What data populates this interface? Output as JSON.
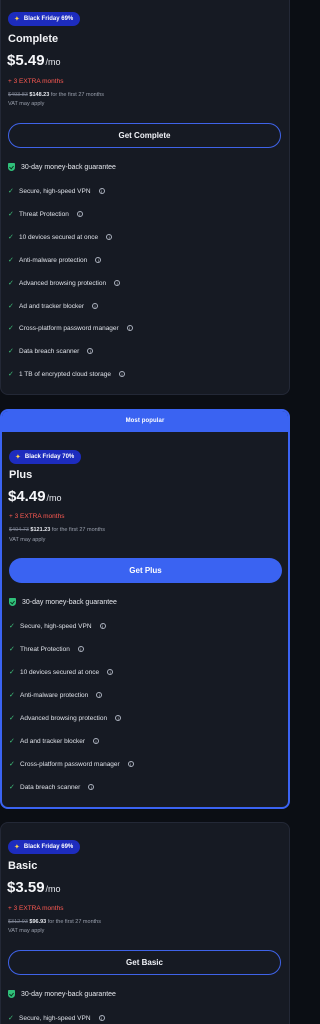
{
  "plans": [
    {
      "badge": "Black Friday 69%",
      "name": "Complete",
      "price": "$5.49",
      "per": "/mo",
      "extra": "+ 3 EXTRA months",
      "old_price": "$493.83",
      "new_price": "$148.23",
      "term": "for the first 27 months",
      "vat": "VAT may apply",
      "cta": "Get Complete",
      "guarantee": "30-day money-back guarantee",
      "features": [
        "Secure, high-speed VPN",
        "Threat Protection",
        "10 devices secured at once",
        "Anti-malware protection",
        "Advanced browsing protection",
        "Ad and tracker blocker",
        "Cross-platform password manager",
        "Data breach scanner",
        "1 TB of encrypted cloud storage"
      ]
    },
    {
      "popular": "Most popular",
      "badge": "Black Friday 70%",
      "name": "Plus",
      "price": "$4.49",
      "per": "/mo",
      "extra": "+ 3 EXTRA months",
      "old_price": "$404.73",
      "new_price": "$121.23",
      "term": "for the first 27 months",
      "vat": "VAT may apply",
      "cta": "Get Plus",
      "guarantee": "30-day money-back guarantee",
      "features": [
        "Secure, high-speed VPN",
        "Threat Protection",
        "10 devices secured at once",
        "Anti-malware protection",
        "Advanced browsing protection",
        "Ad and tracker blocker",
        "Cross-platform password manager",
        "Data breach scanner"
      ]
    },
    {
      "badge": "Black Friday 69%",
      "name": "Basic",
      "price": "$3.59",
      "per": "/mo",
      "extra": "+ 3 EXTRA months",
      "old_price": "$312.93",
      "new_price": "$96.93",
      "term": "for the first 27 months",
      "vat": "VAT may apply",
      "cta": "Get Basic",
      "guarantee": "30-day money-back guarantee",
      "features": [
        "Secure, high-speed VPN"
      ]
    }
  ],
  "icons": {
    "badge": "sparkle-icon",
    "check": "check-icon",
    "info": "info-icon",
    "guarantee": "shield-icon"
  },
  "colors": {
    "accent": "#3a63f2",
    "badge_bg": "#1d2cbe",
    "extra_red": "#ff5a52",
    "check_green": "#3fc07a",
    "card_bg": "#161a23",
    "page_bg": "#0b0e14"
  }
}
